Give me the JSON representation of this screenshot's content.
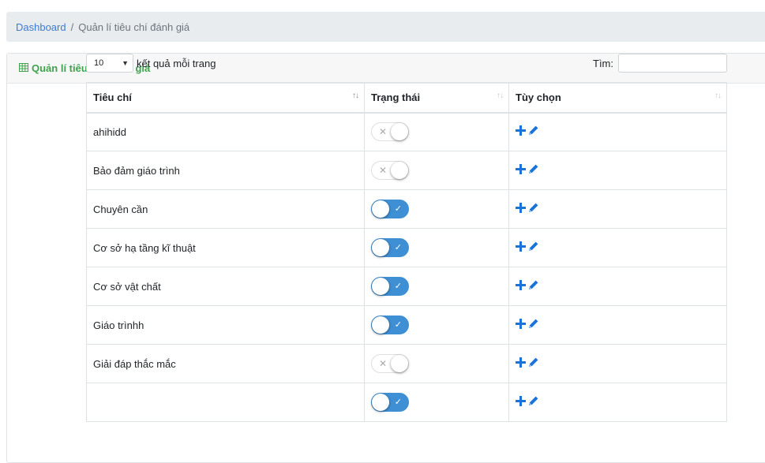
{
  "breadcrumb": {
    "home": "Dashboard",
    "separator": "/",
    "current": "Quản lí tiêu chí đánh giá"
  },
  "card": {
    "title": "Quản lí tiêu chí đánh giá",
    "icon": "table-icon"
  },
  "controls": {
    "page_length": "10",
    "length_suffix": "kết quả mỗi trang",
    "search_label": "Tìm:",
    "search_value": ""
  },
  "table": {
    "columns": [
      "Tiêu chí",
      "Trạng thái",
      "Tùy chọn"
    ],
    "rows": [
      {
        "name": "ahihidd",
        "enabled": false
      },
      {
        "name": "Bảo đảm giáo trình",
        "enabled": false
      },
      {
        "name": "Chuyên cần",
        "enabled": true
      },
      {
        "name": "Cơ sở hạ tầng kĩ thuật",
        "enabled": true
      },
      {
        "name": "Cơ sở vật chất",
        "enabled": true
      },
      {
        "name": "Giáo trìnhh",
        "enabled": true
      },
      {
        "name": "Giải đáp thắc mắc",
        "enabled": false
      },
      {
        "name": "",
        "enabled": true
      }
    ]
  },
  "colors": {
    "accent": "#3fa34d",
    "toggle_on": "#3f8fd5",
    "action_icon": "#1a73d9",
    "link": "#3e7ad0"
  },
  "icons": {
    "add": "plus-icon",
    "edit": "pencil-icon",
    "sort": "sort-icon"
  }
}
